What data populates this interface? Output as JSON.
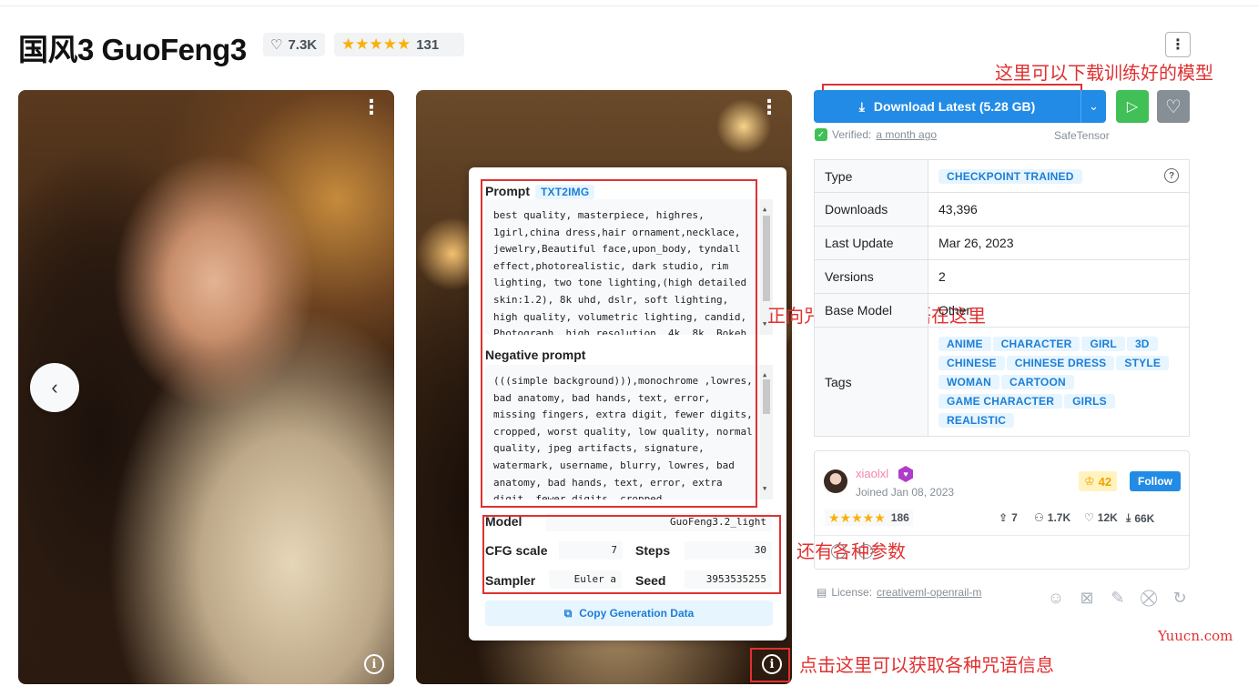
{
  "header": {
    "title": "国风3 GuoFeng3",
    "likes": "7.3K",
    "rating_stars": "★★★★★",
    "rating_count": "131"
  },
  "gallery": {
    "prev_icon": "chevron-left-icon",
    "more_icon": "vertical-dots-icon",
    "info_icon": "info-icon"
  },
  "generation": {
    "prompt_label": "Prompt",
    "prompt_type": "TXT2IMG",
    "prompt_text": "best quality, masterpiece, highres, 1girl,china dress,hair ornament,necklace, jewelry,Beautiful face,upon_body, tyndall effect,photorealistic, dark studio, rim lighting, two tone lighting,(high detailed skin:1.2), 8k uhd, dslr, soft lighting, high quality, volumetric lighting, candid, Photograph, high resolution, 4k, 8k, Bokeh",
    "negative_label": "Negative prompt",
    "negative_text": "(((simple background))),monochrome ,lowres, bad anatomy, bad hands, text, error, missing fingers, extra digit, fewer digits, cropped, worst quality, low quality, normal quality, jpeg artifacts, signature, watermark, username, blurry, lowres, bad anatomy, bad hands, text, error, extra digit, fewer digits, cropped",
    "model_label": "Model",
    "model_value": "GuoFeng3.2_light",
    "cfg_label": "CFG scale",
    "cfg_value": "7",
    "steps_label": "Steps",
    "steps_value": "30",
    "sampler_label": "Sampler",
    "sampler_value": "Euler a",
    "seed_label": "Seed",
    "seed_value": "3953535255",
    "copy_label": "Copy Generation Data"
  },
  "annotations": {
    "download_note": "这里可以下载训练好的模型",
    "prompt_note": "正向咒语和反向咒语在这里",
    "params_note": "还有各种参数",
    "info_note": "点击这里可以获取各种咒语信息"
  },
  "download": {
    "label": "Download Latest (5.28 GB)",
    "verified_prefix": "Verified:",
    "verified_when": "a month ago",
    "format": "SafeTensor"
  },
  "details": {
    "type_label": "Type",
    "type_value": "CHECKPOINT TRAINED",
    "downloads_label": "Downloads",
    "downloads_value": "43,396",
    "last_update_label": "Last Update",
    "last_update_value": "Mar 26, 2023",
    "versions_label": "Versions",
    "versions_value": "2",
    "base_model_label": "Base Model",
    "base_model_value": "Other",
    "tags_label": "Tags",
    "tags": [
      "ANIME",
      "CHARACTER",
      "GIRL",
      "3D",
      "CHINESE",
      "CHINESE DRESS",
      "STYLE",
      "WOMAN",
      "CARTOON",
      "GAME CHARACTER",
      "GIRLS",
      "REALISTIC"
    ]
  },
  "creator": {
    "username": "xiaolxl",
    "joined": "Joined Jan 08, 2023",
    "crown_count": "42",
    "follow_label": "Follow",
    "rating_stars": "★★★★★",
    "rating_count": "186",
    "uploads": "7",
    "followers": "1.7K",
    "favorites": "12K",
    "downloads": "66K"
  },
  "license": {
    "prefix": "License:",
    "name": "creativeml-openrail-m"
  },
  "watermark": "Yuucn.com",
  "colors": {
    "accent": "#228be6",
    "annotation_red": "#e03131",
    "run_green": "#40c057",
    "star": "#fab005"
  }
}
